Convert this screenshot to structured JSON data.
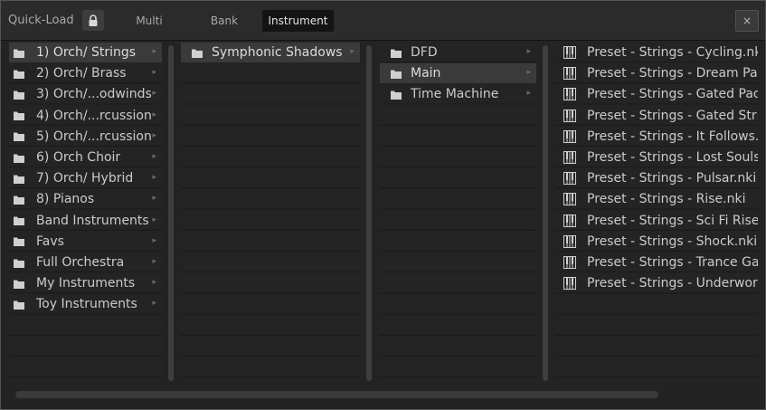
{
  "header": {
    "title": "Quick-Load",
    "lock_icon": "lock-icon",
    "tabs": [
      {
        "label": "Multi"
      },
      {
        "label": "Bank"
      },
      {
        "label": "Instrument"
      }
    ],
    "close_label": "×"
  },
  "columns": {
    "col1": {
      "items": [
        {
          "label": "1) Orch/ Strings"
        },
        {
          "label": "2) Orch/ Brass"
        },
        {
          "label": "3) Orch/...odwinds"
        },
        {
          "label": "4) Orch/...rcussion"
        },
        {
          "label": "5) Orch/...rcussion"
        },
        {
          "label": "6) Orch Choir"
        },
        {
          "label": "7) Orch/ Hybrid"
        },
        {
          "label": "8) Pianos"
        },
        {
          "label": "Band Instruments"
        },
        {
          "label": "Favs"
        },
        {
          "label": "Full Orchestra"
        },
        {
          "label": "My Instruments"
        },
        {
          "label": "Toy Instruments"
        }
      ]
    },
    "col2": {
      "items": [
        {
          "label": "Symphonic Shadows"
        }
      ]
    },
    "col3": {
      "items": [
        {
          "label": "DFD"
        },
        {
          "label": "Main"
        },
        {
          "label": "Time Machine"
        }
      ]
    },
    "col4": {
      "items": [
        {
          "label": "Preset - Strings - Cycling.nki"
        },
        {
          "label": "Preset - Strings - Dream Pad"
        },
        {
          "label": "Preset - Strings - Gated Pad."
        },
        {
          "label": "Preset - Strings - Gated Strin"
        },
        {
          "label": "Preset - Strings - It Follows.n"
        },
        {
          "label": "Preset - Strings - Lost Souls.n"
        },
        {
          "label": "Preset - Strings - Pulsar.nki"
        },
        {
          "label": "Preset - Strings - Rise.nki"
        },
        {
          "label": "Preset - Strings - Sci Fi Riser"
        },
        {
          "label": "Preset - Strings - Shock.nki"
        },
        {
          "label": "Preset - Strings - Trance Gat"
        },
        {
          "label": "Preset - Strings - Underworl"
        }
      ]
    }
  },
  "colors": {
    "background": "#232323",
    "selected_row": "#3a3a3a",
    "text": "#cbcbcb"
  }
}
